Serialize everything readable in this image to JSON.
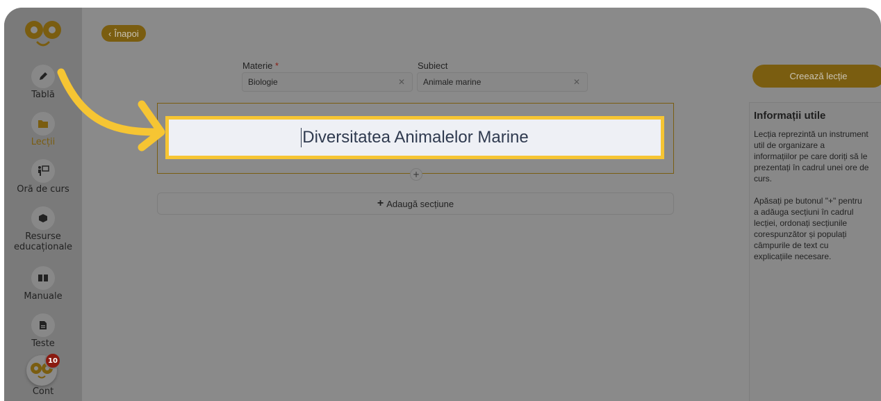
{
  "sidebar": {
    "items": [
      {
        "label": "Tablă",
        "icon": "pencil-icon"
      },
      {
        "label": "Lecții",
        "icon": "folder-icon",
        "active": true
      },
      {
        "label": "Oră de curs",
        "icon": "teacher-board-icon"
      },
      {
        "label": "Resurse",
        "label2": "educaționale",
        "icon": "cube-icon"
      },
      {
        "label": "Manuale",
        "icon": "book-icon"
      },
      {
        "label": "Teste",
        "icon": "document-icon"
      }
    ],
    "account": {
      "label": "Cont",
      "badge": "10"
    }
  },
  "header": {
    "back_label": "Înapoi"
  },
  "form": {
    "materie": {
      "label": "Materie",
      "required_mark": "*",
      "value": "Biologie"
    },
    "subiect": {
      "label": "Subiect",
      "value": "Animale marine"
    },
    "title_value": "Diversitatea Animalelor Marine",
    "add_section_label": "Adaugă secțiune",
    "insert_plus": "+"
  },
  "actions": {
    "create_label": "Creează lecție"
  },
  "info": {
    "title": "Informații utile",
    "p1": [
      "Lecția reprezintă un instrument",
      "util de organizare a",
      "informațiilor pe care doriți să le",
      "prezentați în cadrul unei ore de",
      "curs."
    ],
    "p2": [
      "Apăsați pe butonul \"+\" pentru",
      "a adăuga secțiuni în cadrul",
      "lecției, ordonați secțiunile",
      "corespunzător și populați",
      "câmpurile de text cu",
      "explicațiile necesare."
    ]
  },
  "colors": {
    "accent": "#7a5d10",
    "highlight": "#f6c533",
    "overlay": "#8a8a8a"
  }
}
